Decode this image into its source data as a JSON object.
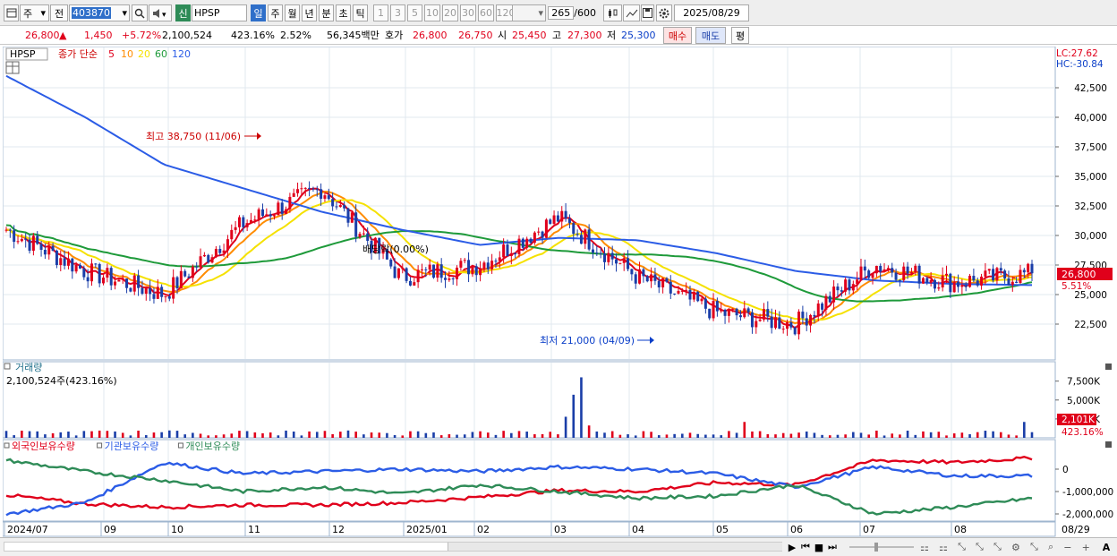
{
  "toolbar": {
    "market": "주",
    "prev": "전",
    "code": "403870",
    "badge": "신",
    "name": "HPSP",
    "periods": [
      "일",
      "주",
      "월",
      "년",
      "분",
      "초",
      "틱"
    ],
    "selected_period": "일",
    "intervals": [
      "1",
      "3",
      "5",
      "10",
      "20",
      "30",
      "60",
      "120"
    ],
    "count": "265",
    "max": "/600",
    "date": "2025/08/29"
  },
  "quote": {
    "price": "26,800",
    "arrow": "▲",
    "change": "1,450",
    "change_pct": "+5.72%",
    "volume": "2,100,524",
    "vol_ratio": "423.16%",
    "turnover_pct": "2.52%",
    "trade_value": "56,345백만",
    "hoga_label": "호가",
    "ask": "26,800",
    "bid": "26,750",
    "open_label": "시",
    "open": "25,450",
    "high_label": "고",
    "high": "27,300",
    "low_label": "저",
    "low": "25,300",
    "buy": "매수",
    "sell": "매도",
    "eval": "평"
  },
  "price_panel": {
    "symbol": "HPSP",
    "ma_title": "종가 단순",
    "ma_periods": [
      "5",
      "10",
      "20",
      "60",
      "120"
    ],
    "ma_colors": [
      "#e0001b",
      "#ff8c00",
      "#f5e100",
      "#1e9a3a",
      "#2b5ce6"
    ],
    "lc": "LC:27.62",
    "hc": "HC:-30.84",
    "yticks": [
      "42,500",
      "40,000",
      "37,500",
      "35,000",
      "32,500",
      "30,000",
      "27,500",
      "25,000",
      "22,500"
    ],
    "last_price": "26,800",
    "last_pct": "5.51%",
    "annot_high": "최고 38,750 (11/06)",
    "annot_low": "최저 21,000 (04/09)",
    "annot_div": "배당락(0.00%)"
  },
  "volume_panel": {
    "title": "거래량",
    "value": "2,100,524주(423.16%)",
    "yticks": [
      "7,500K",
      "5,000K",
      "2,500K"
    ],
    "last": "2,101K",
    "last_pct": "423.16%"
  },
  "holding_panel": {
    "series": [
      "외국인보유수량",
      "기관보유수량",
      "개인보유수량"
    ],
    "colors": [
      "#e0001b",
      "#2b5ce6",
      "#2e8b57"
    ],
    "yticks": [
      "0",
      "-1,000,000",
      "-2,000,000"
    ]
  },
  "xaxis": {
    "labels": [
      "2024/07",
      "09",
      "10",
      "11",
      "12",
      "2025/01",
      "02",
      "03",
      "04",
      "05",
      "06",
      "07",
      "08"
    ],
    "end_label": "08/29"
  },
  "chart_data": {
    "type": "candlestick",
    "title": "HPSP",
    "ylim": [
      20000,
      44000
    ],
    "dates": [
      "2024/07",
      "08",
      "09",
      "10",
      "11",
      "12",
      "2025/01",
      "02",
      "03",
      "04",
      "05",
      "06",
      "07",
      "08"
    ],
    "close": [
      30500,
      27000,
      25000,
      31000,
      34000,
      26500,
      27500,
      31500,
      26500,
      23500,
      22500,
      27500,
      26000,
      26800
    ],
    "ma5": [
      30500,
      27200,
      24500,
      30500,
      33800,
      26300,
      27300,
      32000,
      26000,
      23300,
      22400,
      28200,
      25600,
      26300
    ],
    "ma120": [
      43500,
      40000,
      36000,
      34000,
      32000,
      30500,
      29200,
      29800,
      29600,
      28500,
      27000,
      26200,
      25900,
      25800
    ],
    "volume_k": [
      700,
      600,
      500,
      500,
      7000,
      500,
      450,
      1800,
      600,
      500,
      400,
      1600,
      500,
      1000
    ],
    "holdings": {
      "foreign": [
        -1150000,
        -1550000,
        -1700000,
        -1600000,
        -1600000,
        -1500000,
        -1250000,
        -950000,
        -1000000,
        -600000,
        -700000,
        400000,
        300000,
        500000
      ],
      "institution": [
        -2000000,
        -1500000,
        300000,
        -200000,
        -100000,
        0,
        -100000,
        100000,
        0,
        -200000,
        -800000,
        100000,
        -300000,
        -300000
      ],
      "individual": [
        400000,
        -100000,
        -500000,
        -1000000,
        -800000,
        -1100000,
        -700000,
        -1000000,
        -1300000,
        -1200000,
        -700000,
        -2000000,
        -1700000,
        -1300000
      ]
    }
  }
}
